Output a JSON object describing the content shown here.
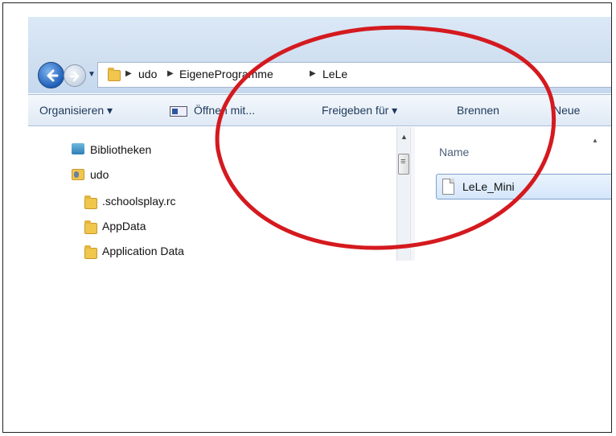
{
  "breadcrumb": {
    "items": [
      "udo",
      "EigeneProgramme",
      "LeLe"
    ]
  },
  "toolbar": {
    "organize": "Organisieren ▾",
    "open_with": "Öffnen mit...",
    "share_with": "Freigeben für ▾",
    "burn": "Brennen",
    "new_folder": "Neue"
  },
  "nav_tree": {
    "items": [
      "Bibliotheken",
      "udo",
      ".schoolsplay.rc",
      "AppData",
      "Application Data"
    ]
  },
  "file_list": {
    "column_name": "Name",
    "files": [
      "LeLe_Mini"
    ]
  },
  "annotation": {
    "color": "#d41a1f"
  },
  "colors": {
    "accent": "#1f5fb8",
    "selection": "#d5e6fb"
  }
}
